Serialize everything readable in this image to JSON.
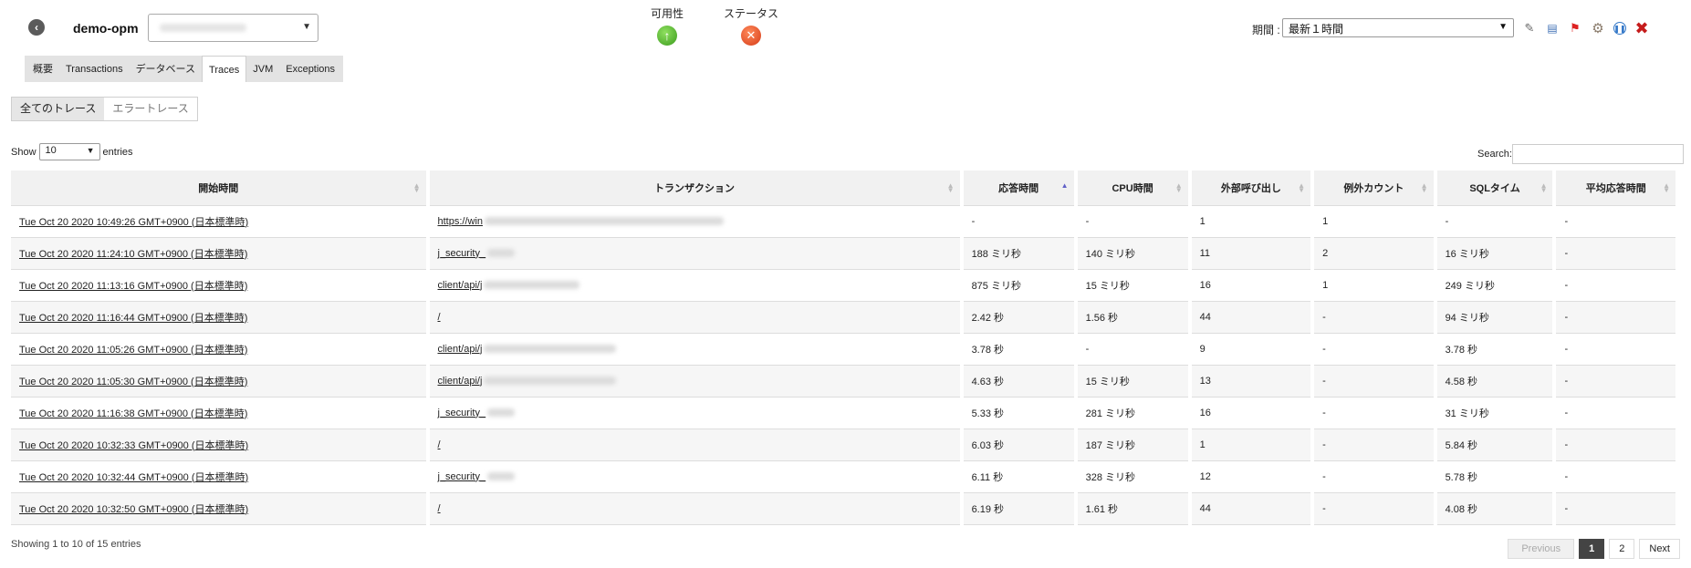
{
  "header": {
    "back_icon": "chevron-left-icon",
    "monitor_name": "demo-opm",
    "availability_label": "可用性",
    "availability_icon": "arrow-up-icon",
    "availability_color": "#3b9b1e",
    "status_label": "ステータス",
    "status_icon": "x-circle-icon",
    "status_color": "#d53b17",
    "period_label": "期間 :",
    "period_value": "最新１時間",
    "tools": [
      "pencil-icon",
      "report-icon",
      "traffic-light-icon",
      "gear-icon",
      "pause-icon",
      "close-icon"
    ]
  },
  "tabs": [
    {
      "label": "概要"
    },
    {
      "label": "Transactions"
    },
    {
      "label": "データベース"
    },
    {
      "label": "Traces"
    },
    {
      "label": "JVM"
    },
    {
      "label": "Exceptions"
    }
  ],
  "subtabs": [
    {
      "label": "全てのトレース"
    },
    {
      "label": "エラートレース"
    }
  ],
  "show": {
    "prefix": "Show",
    "value": "10",
    "suffix": "entries"
  },
  "search": {
    "label": "Search:",
    "value": ""
  },
  "table": {
    "columns": [
      "開始時間",
      "トランザクション",
      "応答時間",
      "CPU時間",
      "外部呼び出し",
      "例外カウント",
      "SQLタイム",
      "平均応答時間"
    ],
    "rows": [
      {
        "start": "Tue Oct 20 2020 10:49:26 GMT+0900 (日本標準時)",
        "txn": "https://win",
        "resp": "-",
        "cpu": "-",
        "ext": "1",
        "exc": "1",
        "sql": "-",
        "avg": "-"
      },
      {
        "start": "Tue Oct 20 2020 11:24:10 GMT+0900 (日本標準時)",
        "txn": "j_security_",
        "resp": "188 ミリ秒",
        "cpu": "140 ミリ秒",
        "ext": "11",
        "exc": "2",
        "sql": "16 ミリ秒",
        "avg": "-"
      },
      {
        "start": "Tue Oct 20 2020 11:13:16 GMT+0900 (日本標準時)",
        "txn": "client/api/j",
        "resp": "875 ミリ秒",
        "cpu": "15 ミリ秒",
        "ext": "16",
        "exc": "1",
        "sql": "249 ミリ秒",
        "avg": "-"
      },
      {
        "start": "Tue Oct 20 2020 11:16:44 GMT+0900 (日本標準時)",
        "txn": "/",
        "resp": "2.42 秒",
        "cpu": "1.56 秒",
        "ext": "44",
        "exc": "-",
        "sql": "94 ミリ秒",
        "avg": "-"
      },
      {
        "start": "Tue Oct 20 2020 11:05:26 GMT+0900 (日本標準時)",
        "txn": "client/api/j",
        "resp": "3.78 秒",
        "cpu": "-",
        "ext": "9",
        "exc": "-",
        "sql": "3.78 秒",
        "avg": "-"
      },
      {
        "start": "Tue Oct 20 2020 11:05:30 GMT+0900 (日本標準時)",
        "txn": "client/api/j",
        "resp": "4.63 秒",
        "cpu": "15 ミリ秒",
        "ext": "13",
        "exc": "-",
        "sql": "4.58 秒",
        "avg": "-"
      },
      {
        "start": "Tue Oct 20 2020 11:16:38 GMT+0900 (日本標準時)",
        "txn": "j_security_",
        "resp": "5.33 秒",
        "cpu": "281 ミリ秒",
        "ext": "16",
        "exc": "-",
        "sql": "31 ミリ秒",
        "avg": "-"
      },
      {
        "start": "Tue Oct 20 2020 10:32:33 GMT+0900 (日本標準時)",
        "txn": "/",
        "resp": "6.03 秒",
        "cpu": "187 ミリ秒",
        "ext": "1",
        "exc": "-",
        "sql": "5.84 秒",
        "avg": "-"
      },
      {
        "start": "Tue Oct 20 2020 10:32:44 GMT+0900 (日本標準時)",
        "txn": "j_security_",
        "resp": "6.11 秒",
        "cpu": "328 ミリ秒",
        "ext": "12",
        "exc": "-",
        "sql": "5.78 秒",
        "avg": "-"
      },
      {
        "start": "Tue Oct 20 2020 10:32:50 GMT+0900 (日本標準時)",
        "txn": "/",
        "resp": "6.19 秒",
        "cpu": "1.61 秒",
        "ext": "44",
        "exc": "-",
        "sql": "4.08 秒",
        "avg": "-"
      }
    ]
  },
  "footer": {
    "info": "Showing 1 to 10 of 15 entries",
    "prev": "Previous",
    "pages": [
      "1",
      "2"
    ],
    "next": "Next"
  }
}
